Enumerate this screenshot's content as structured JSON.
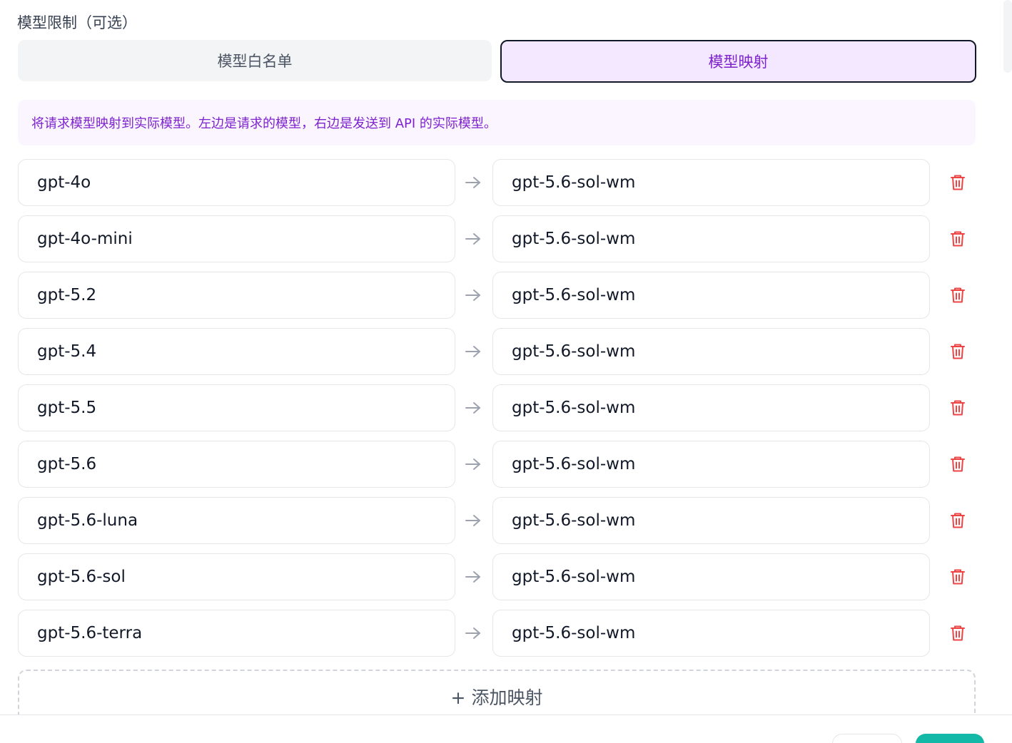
{
  "section": {
    "label": "模型限制（可选）"
  },
  "tabs": [
    {
      "label": "模型白名单",
      "active": false
    },
    {
      "label": "模型映射",
      "active": true
    }
  ],
  "info": {
    "text": "将请求模型映射到实际模型。左边是请求的模型，右边是发送到 API 的实际模型。"
  },
  "mappings": [
    {
      "source": "gpt-4o",
      "target": "gpt-5.6-sol-wm"
    },
    {
      "source": "gpt-4o-mini",
      "target": "gpt-5.6-sol-wm"
    },
    {
      "source": "gpt-5.2",
      "target": "gpt-5.6-sol-wm"
    },
    {
      "source": "gpt-5.4",
      "target": "gpt-5.6-sol-wm"
    },
    {
      "source": "gpt-5.5",
      "target": "gpt-5.6-sol-wm"
    },
    {
      "source": "gpt-5.6",
      "target": "gpt-5.6-sol-wm"
    },
    {
      "source": "gpt-5.6-luna",
      "target": "gpt-5.6-sol-wm"
    },
    {
      "source": "gpt-5.6-sol",
      "target": "gpt-5.6-sol-wm"
    },
    {
      "source": "gpt-5.6-terra",
      "target": "gpt-5.6-sol-wm"
    }
  ],
  "add_button": {
    "label": "+ 添加映射"
  },
  "icons": {
    "arrow": "arrow-right-icon",
    "delete": "trash-icon"
  },
  "colors": {
    "accent": "#7e22ce",
    "accent_bg": "#f3e8ff",
    "info_bg": "#faf5ff",
    "danger": "#ef4444",
    "primary": "#14b8a6"
  }
}
